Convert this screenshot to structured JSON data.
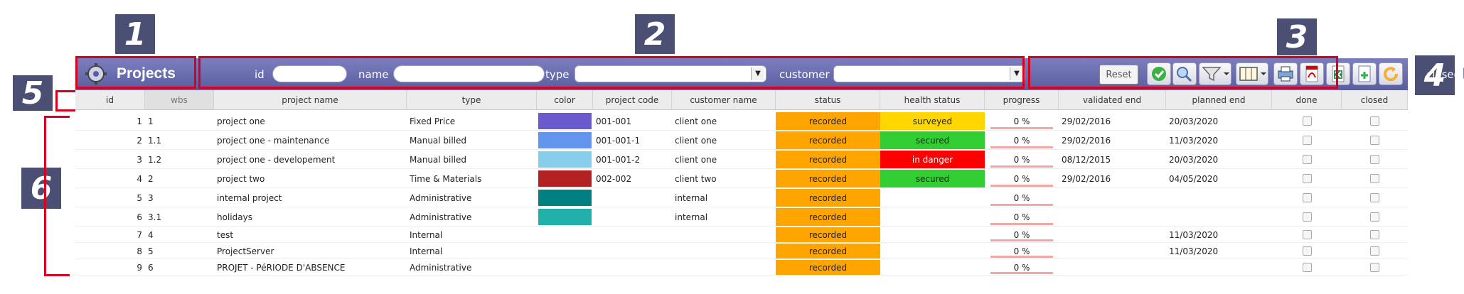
{
  "callouts": [
    "1",
    "2",
    "3",
    "4",
    "5",
    "6"
  ],
  "toolbar": {
    "title": "Projects",
    "icon": "gear-icon",
    "filters": {
      "id_label": "id",
      "name_label": "name",
      "type_label": "type",
      "customer_label": "customer"
    },
    "reset_label": "Reset",
    "buttons": [
      "check-icon",
      "search-icon",
      "filter-icon",
      "columns-icon",
      "print-icon",
      "pdf-icon",
      "excel-icon",
      "new-document-icon",
      "refresh-icon"
    ],
    "closed_label": "closed"
  },
  "columns": [
    "id",
    "wbs",
    "project name",
    "type",
    "color",
    "project code",
    "customer name",
    "status",
    "health status",
    "progress",
    "validated end",
    "planned end",
    "done",
    "closed"
  ],
  "colors": {
    "recorded": "#ffa500",
    "surveyed": "#ffd700",
    "secured": "#32cd32",
    "in_danger": "#ff0000"
  },
  "rows": [
    {
      "id": "1",
      "wbs": "1",
      "name": "project one",
      "type": "Fixed Price",
      "color": "#6a5acd",
      "code": "001-001",
      "customer": "client one",
      "status": "recorded",
      "health": "surveyed",
      "health_color": "#ffd700",
      "progress": "0 %",
      "validated": "29/02/2016",
      "planned": "20/03/2020"
    },
    {
      "id": "2",
      "wbs": "1.1",
      "name": "project one - maintenance",
      "type": "Manual billed",
      "color": "#6495ed",
      "code": "001-001-1",
      "customer": "client one",
      "status": "recorded",
      "health": "secured",
      "health_color": "#32cd32",
      "progress": "0 %",
      "validated": "29/02/2016",
      "planned": "11/03/2020"
    },
    {
      "id": "3",
      "wbs": "1.2",
      "name": "project one - developement",
      "type": "Manual billed",
      "color": "#87ceeb",
      "code": "001-001-2",
      "customer": "client one",
      "status": "recorded",
      "health": "in danger",
      "health_color": "#ff0000",
      "progress": "0 %",
      "validated": "08/12/2015",
      "planned": "20/03/2020"
    },
    {
      "id": "4",
      "wbs": "2",
      "name": "project two",
      "type": "Time & Materials",
      "color": "#b22222",
      "code": "002-002",
      "customer": "client two",
      "status": "recorded",
      "health": "secured",
      "health_color": "#32cd32",
      "progress": "0 %",
      "validated": "29/02/2016",
      "planned": "04/05/2020"
    },
    {
      "id": "5",
      "wbs": "3",
      "name": "internal project",
      "type": "Administrative",
      "color": "#008080",
      "code": "",
      "customer": "internal",
      "status": "recorded",
      "health": "",
      "health_color": "",
      "progress": "0 %",
      "validated": "",
      "planned": ""
    },
    {
      "id": "6",
      "wbs": "3.1",
      "name": "holidays",
      "type": "Administrative",
      "color": "#20b2aa",
      "code": "",
      "customer": "internal",
      "status": "recorded",
      "health": "",
      "health_color": "",
      "progress": "0 %",
      "validated": "",
      "planned": ""
    },
    {
      "id": "7",
      "wbs": "4",
      "name": "test",
      "type": "Internal",
      "color": "",
      "code": "",
      "customer": "",
      "status": "recorded",
      "health": "",
      "health_color": "",
      "progress": "0 %",
      "validated": "",
      "planned": "11/03/2020"
    },
    {
      "id": "8",
      "wbs": "5",
      "name": "ProjectServer",
      "type": "Internal",
      "color": "",
      "code": "",
      "customer": "",
      "status": "recorded",
      "health": "",
      "health_color": "",
      "progress": "0 %",
      "validated": "",
      "planned": "11/03/2020"
    },
    {
      "id": "9",
      "wbs": "6",
      "name": "PROJET - PéRIODE D'ABSENCE",
      "type": "Administrative",
      "color": "",
      "code": "",
      "customer": "",
      "status": "recorded",
      "health": "",
      "health_color": "",
      "progress": "0 %",
      "validated": "",
      "planned": ""
    }
  ]
}
